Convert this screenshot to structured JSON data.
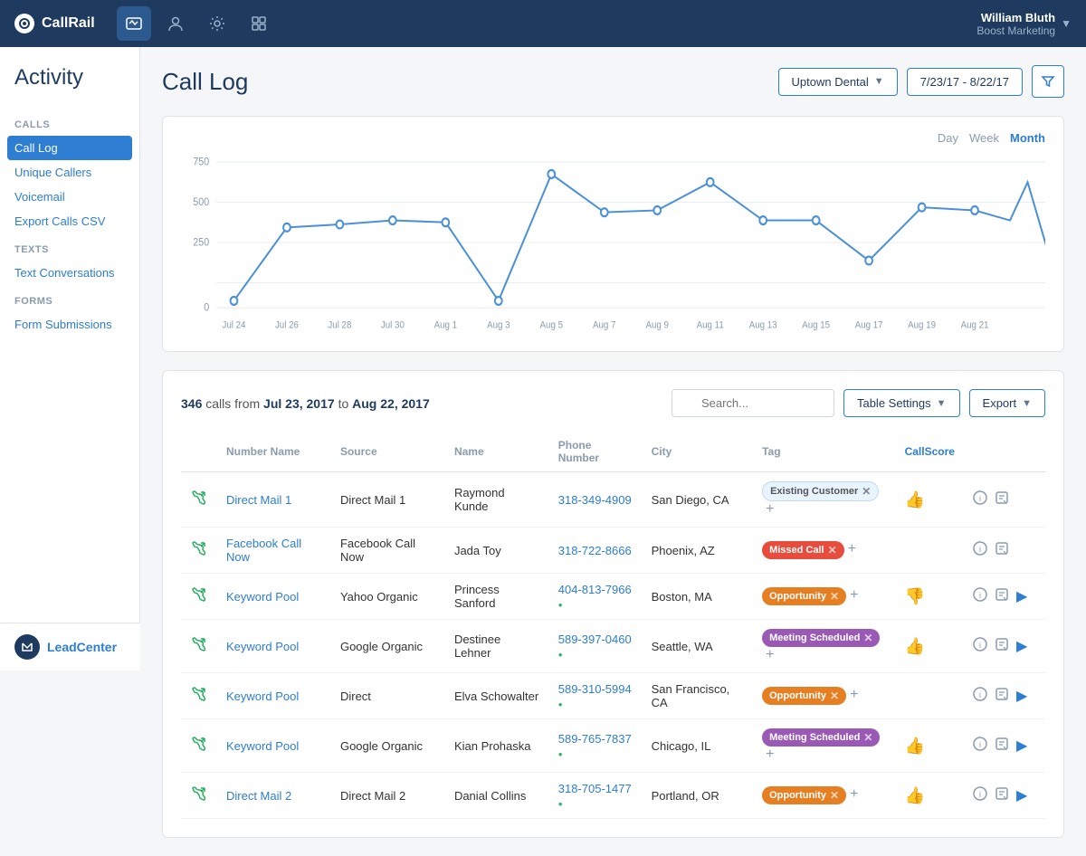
{
  "app": {
    "name": "CallRail"
  },
  "nav": {
    "user_name": "William Bluth",
    "company": "Boost Marketing",
    "icons": [
      "activity",
      "person",
      "settings",
      "gear2"
    ]
  },
  "sidebar": {
    "title": "Activity",
    "calls_label": "CALLS",
    "items_calls": [
      {
        "id": "call-log",
        "label": "Call Log",
        "active": true
      },
      {
        "id": "unique-callers",
        "label": "Unique Callers",
        "active": false
      },
      {
        "id": "voicemail",
        "label": "Voicemail",
        "active": false
      },
      {
        "id": "export-csv",
        "label": "Export Calls CSV",
        "active": false
      }
    ],
    "texts_label": "TEXTS",
    "items_texts": [
      {
        "id": "text-conversations",
        "label": "Text Conversations",
        "active": false
      }
    ],
    "forms_label": "FORMS",
    "items_forms": [
      {
        "id": "form-submissions",
        "label": "Form Submissions",
        "active": false
      }
    ],
    "lead_center_label": "LeadCenter"
  },
  "page": {
    "title": "Call Log"
  },
  "header_controls": {
    "company_name": "Uptown Dental",
    "date_range": "7/23/17 - 8/22/17"
  },
  "chart": {
    "time_labels": [
      "Day",
      "Week",
      "Month"
    ],
    "active_time": "Month",
    "y_labels": [
      "750",
      "500",
      "250",
      "0"
    ],
    "x_labels": [
      "Jul 24",
      "Jul 26",
      "Jul 28",
      "Jul 30",
      "Aug 1",
      "Aug 3",
      "Aug 5",
      "Aug 7",
      "Aug 9",
      "Aug 11",
      "Aug 13",
      "Aug 15",
      "Aug 17",
      "Aug 19",
      "Aug 21"
    ]
  },
  "table": {
    "summary_calls": "346",
    "summary_from": "Jul 23, 2017",
    "summary_to": "Aug 22, 2017",
    "search_placeholder": "Search...",
    "settings_label": "Table Settings",
    "export_label": "Export",
    "columns": [
      "Number Name",
      "Source",
      "Name",
      "Phone Number",
      "City",
      "Tag",
      "CallScore"
    ],
    "rows": [
      {
        "id": 1,
        "number_name": "Direct Mail 1",
        "source": "Direct Mail 1",
        "name": "Raymond Kunde",
        "phone": "318-349-4909",
        "phone_green": false,
        "city": "San Diego, CA",
        "tags": [
          {
            "label": "Existing Customer",
            "type": "existing"
          }
        ],
        "thumb": "up",
        "has_play": false
      },
      {
        "id": 2,
        "number_name": "Facebook Call Now",
        "source": "Facebook Call Now",
        "name": "Jada Toy",
        "phone": "318-722-8666",
        "phone_green": false,
        "city": "Phoenix, AZ",
        "tags": [
          {
            "label": "Missed Call",
            "type": "missed"
          }
        ],
        "thumb": "none",
        "has_play": false
      },
      {
        "id": 3,
        "number_name": "Keyword Pool",
        "source": "Yahoo Organic",
        "name": "Princess Sanford",
        "phone": "404-813-7966",
        "phone_green": true,
        "city": "Boston, MA",
        "tags": [
          {
            "label": "Opportunity",
            "type": "opportunity"
          }
        ],
        "thumb": "down",
        "has_play": true
      },
      {
        "id": 4,
        "number_name": "Keyword Pool",
        "source": "Google Organic",
        "name": "Destinee Lehner",
        "phone": "589-397-0460",
        "phone_green": true,
        "city": "Seattle, WA",
        "tags": [
          {
            "label": "Meeting Scheduled",
            "type": "meeting"
          }
        ],
        "thumb": "up",
        "has_play": true
      },
      {
        "id": 5,
        "number_name": "Keyword Pool",
        "source": "Direct",
        "name": "Elva Schowalter",
        "phone": "589-310-5994",
        "phone_green": true,
        "city": "San Francisco, CA",
        "tags": [
          {
            "label": "Opportunity",
            "type": "opportunity"
          }
        ],
        "thumb": "none",
        "has_play": true
      },
      {
        "id": 6,
        "number_name": "Keyword Pool",
        "source": "Google Organic",
        "name": "Kian Prohaska",
        "phone": "589-765-7837",
        "phone_green": true,
        "city": "Chicago, IL",
        "tags": [
          {
            "label": "Meeting Scheduled",
            "type": "meeting"
          }
        ],
        "thumb": "up",
        "has_play": true
      },
      {
        "id": 7,
        "number_name": "Direct Mail 2",
        "source": "Direct Mail 2",
        "name": "Danial Collins",
        "phone": "318-705-1477",
        "phone_green": true,
        "city": "Portland, OR",
        "tags": [
          {
            "label": "Opportunity",
            "type": "opportunity"
          }
        ],
        "thumb": "up",
        "has_play": true
      }
    ]
  }
}
